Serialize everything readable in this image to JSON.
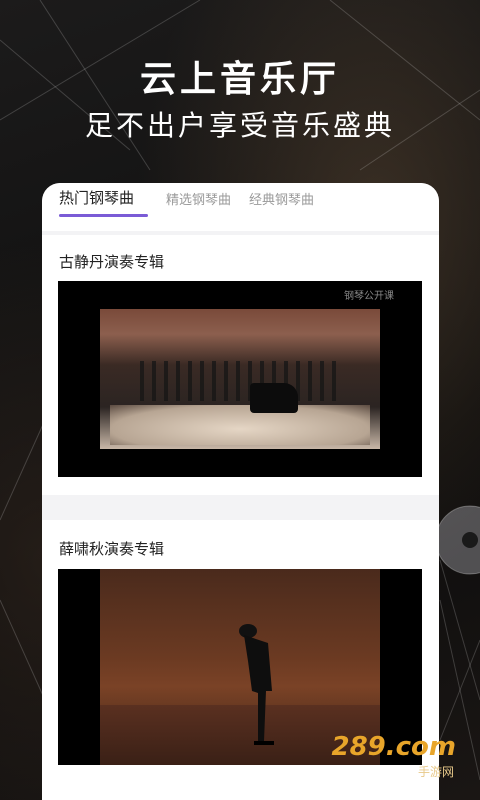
{
  "hero": {
    "title": "云上音乐厅",
    "subtitle": "足不出户享受音乐盛典"
  },
  "tabs": [
    {
      "label": "热门钢琴曲",
      "active": true
    },
    {
      "label": "精选钢琴曲",
      "active": false
    },
    {
      "label": "经典钢琴曲",
      "active": false
    }
  ],
  "sections": [
    {
      "title": "古静丹演奏专辑",
      "watermark": "钢琴公开课"
    },
    {
      "title": "薛啸秋演奏专辑"
    }
  ],
  "site_logo": {
    "text": "289.com",
    "sub": "手游网"
  },
  "colors": {
    "accent": "#7a5bd6",
    "card_bg": "#f3f3f5",
    "logo": "#e8a52a"
  }
}
